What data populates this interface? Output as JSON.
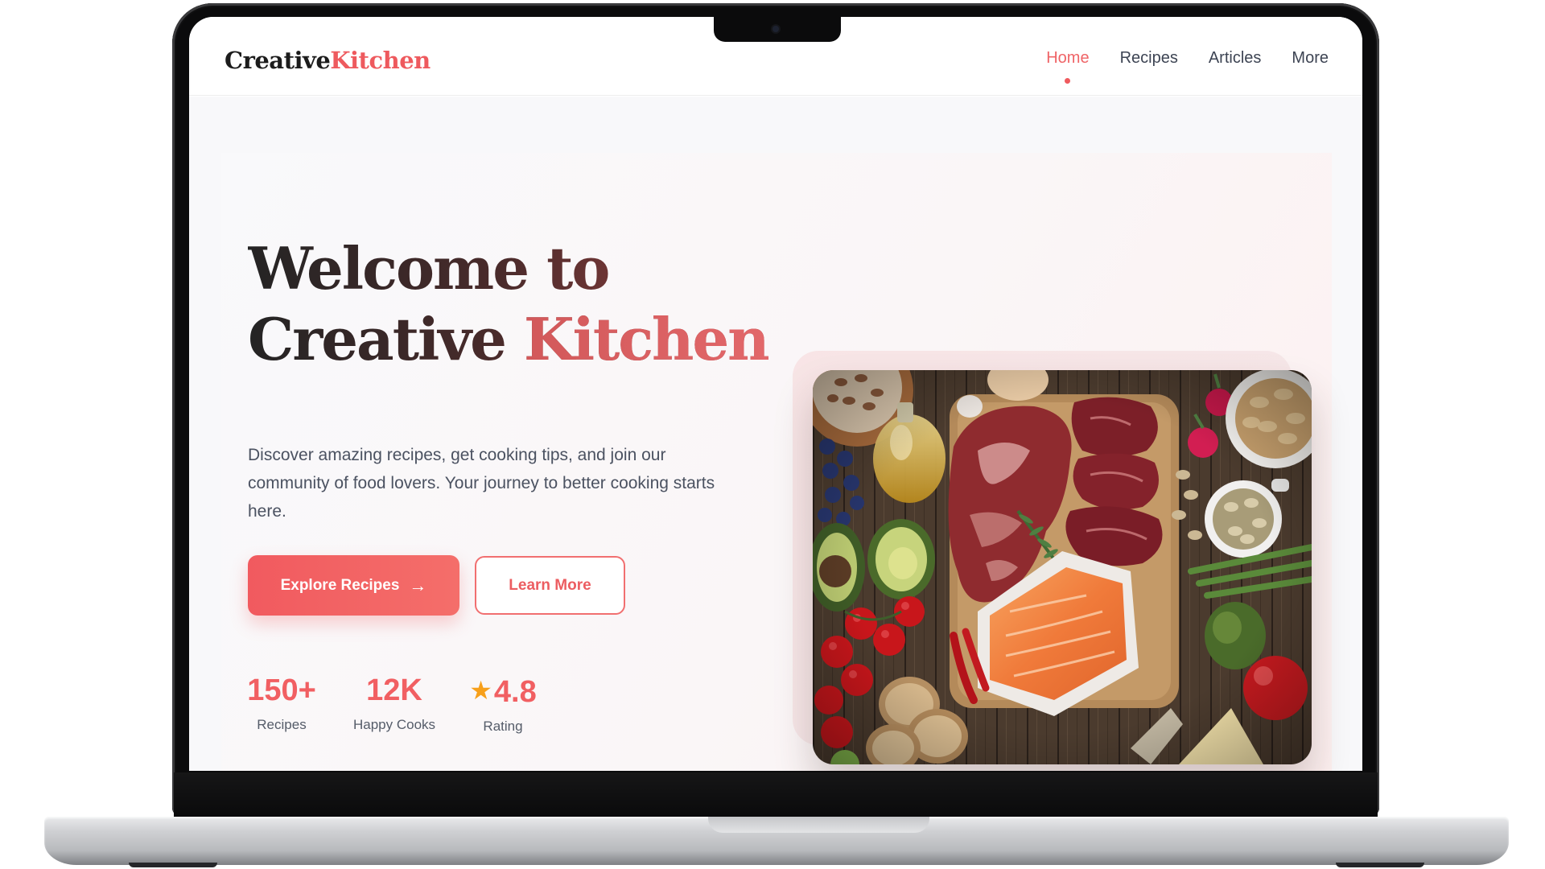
{
  "site": {
    "logo_part1": "Creative",
    "logo_part2": "Kitchen",
    "nav": [
      {
        "label": "Home",
        "active": true
      },
      {
        "label": "Recipes",
        "active": false
      },
      {
        "label": "Articles",
        "active": false
      },
      {
        "label": "More",
        "active": false
      }
    ]
  },
  "hero": {
    "title_line1": "Welcome to",
    "title_line2a": "Creative ",
    "title_line2b": "Kitchen",
    "subtitle": "Discover amazing recipes, get cooking tips, and join our community of food lovers. Your journey to better cooking starts here.",
    "primary_button": "Explore Recipes",
    "secondary_button": "Learn More",
    "stats": [
      {
        "value": "150+",
        "label": "Recipes"
      },
      {
        "value": "12K",
        "label": "Happy Cooks"
      },
      {
        "value": "4.8",
        "label": "Rating"
      }
    ]
  },
  "icons": {
    "button_arrow": "arrow-right-icon",
    "rating": "star-icon"
  },
  "colors": {
    "accent": "#EF5A5E",
    "rating_star": "#F7A01B",
    "dark_text": "#1C1C1C"
  }
}
